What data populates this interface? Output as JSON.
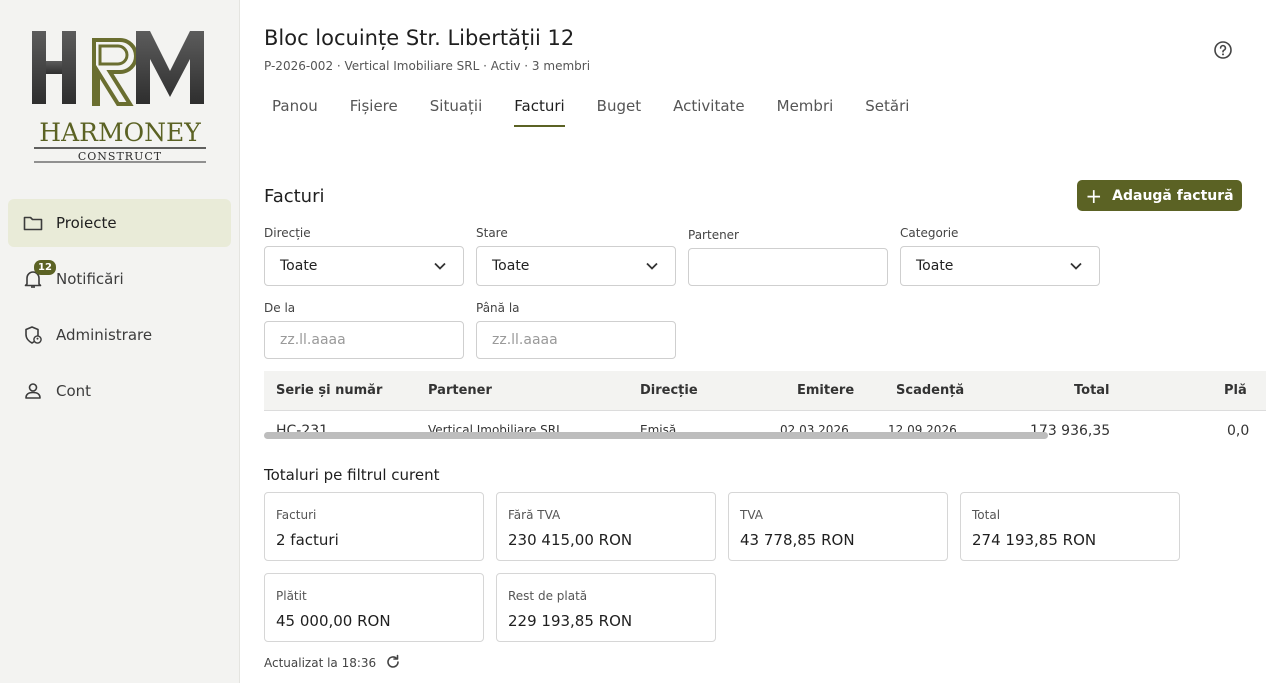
{
  "brand": {
    "logo_text": "HRM",
    "name": "HARMONEY",
    "sub": "CONSTRUCT",
    "color": "#5b6224"
  },
  "sidebar": {
    "items": [
      {
        "label": "Proiecte",
        "icon": "folder-icon",
        "active": true
      },
      {
        "label": "Notificări",
        "icon": "bell-icon",
        "badge": "12"
      },
      {
        "label": "Administrare",
        "icon": "admin-shield-icon"
      },
      {
        "label": "Cont",
        "icon": "user-icon"
      }
    ]
  },
  "project": {
    "title": "Bloc locuințe Str. Libertății 12",
    "subtitle": "P-2026-002 · Vertical Imobiliare SRL · Activ · 3 membri"
  },
  "tabs": [
    "Panou",
    "Fișiere",
    "Situații",
    "Facturi",
    "Buget",
    "Activitate",
    "Membri",
    "Setări"
  ],
  "active_tab": "Facturi",
  "invoices": {
    "title": "Facturi",
    "add_button": "Adaugă factură",
    "filters": {
      "directie": {
        "label": "Direcție",
        "value": "Toate"
      },
      "stare": {
        "label": "Stare",
        "value": "Toate"
      },
      "partener": {
        "label": "Partener",
        "value": ""
      },
      "categorie": {
        "label": "Categorie",
        "value": "Toate"
      },
      "de_la": {
        "label": "De la",
        "placeholder": "zz.ll.aaaa"
      },
      "pana_la": {
        "label": "Până la",
        "placeholder": "zz.ll.aaaa"
      }
    },
    "columns": [
      "Serie și număr",
      "Partener",
      "Direcție",
      "Emitere",
      "Scadență",
      "Total",
      "Plă"
    ],
    "rows": [
      {
        "serie": "HC-231",
        "partener": "Vertical Imobiliare SRL",
        "directie": "Emisă",
        "emitere": "02.03.2026",
        "scadenta": "12.09.2026",
        "total": "173 936,35",
        "platit": "0,0"
      }
    ]
  },
  "totals": {
    "title": "Totaluri pe filtrul curent",
    "cards": [
      {
        "label": "Facturi",
        "value": "2 facturi"
      },
      {
        "label": "Fără TVA",
        "value": "230 415,00 RON"
      },
      {
        "label": "TVA",
        "value": "43 778,85 RON"
      },
      {
        "label": "Total",
        "value": "274 193,85 RON"
      },
      {
        "label": "Plătit",
        "value": "45 000,00 RON"
      },
      {
        "label": "Rest de plată",
        "value": "229 193,85 RON"
      }
    ]
  },
  "updated": "Actualizat la 18:36"
}
